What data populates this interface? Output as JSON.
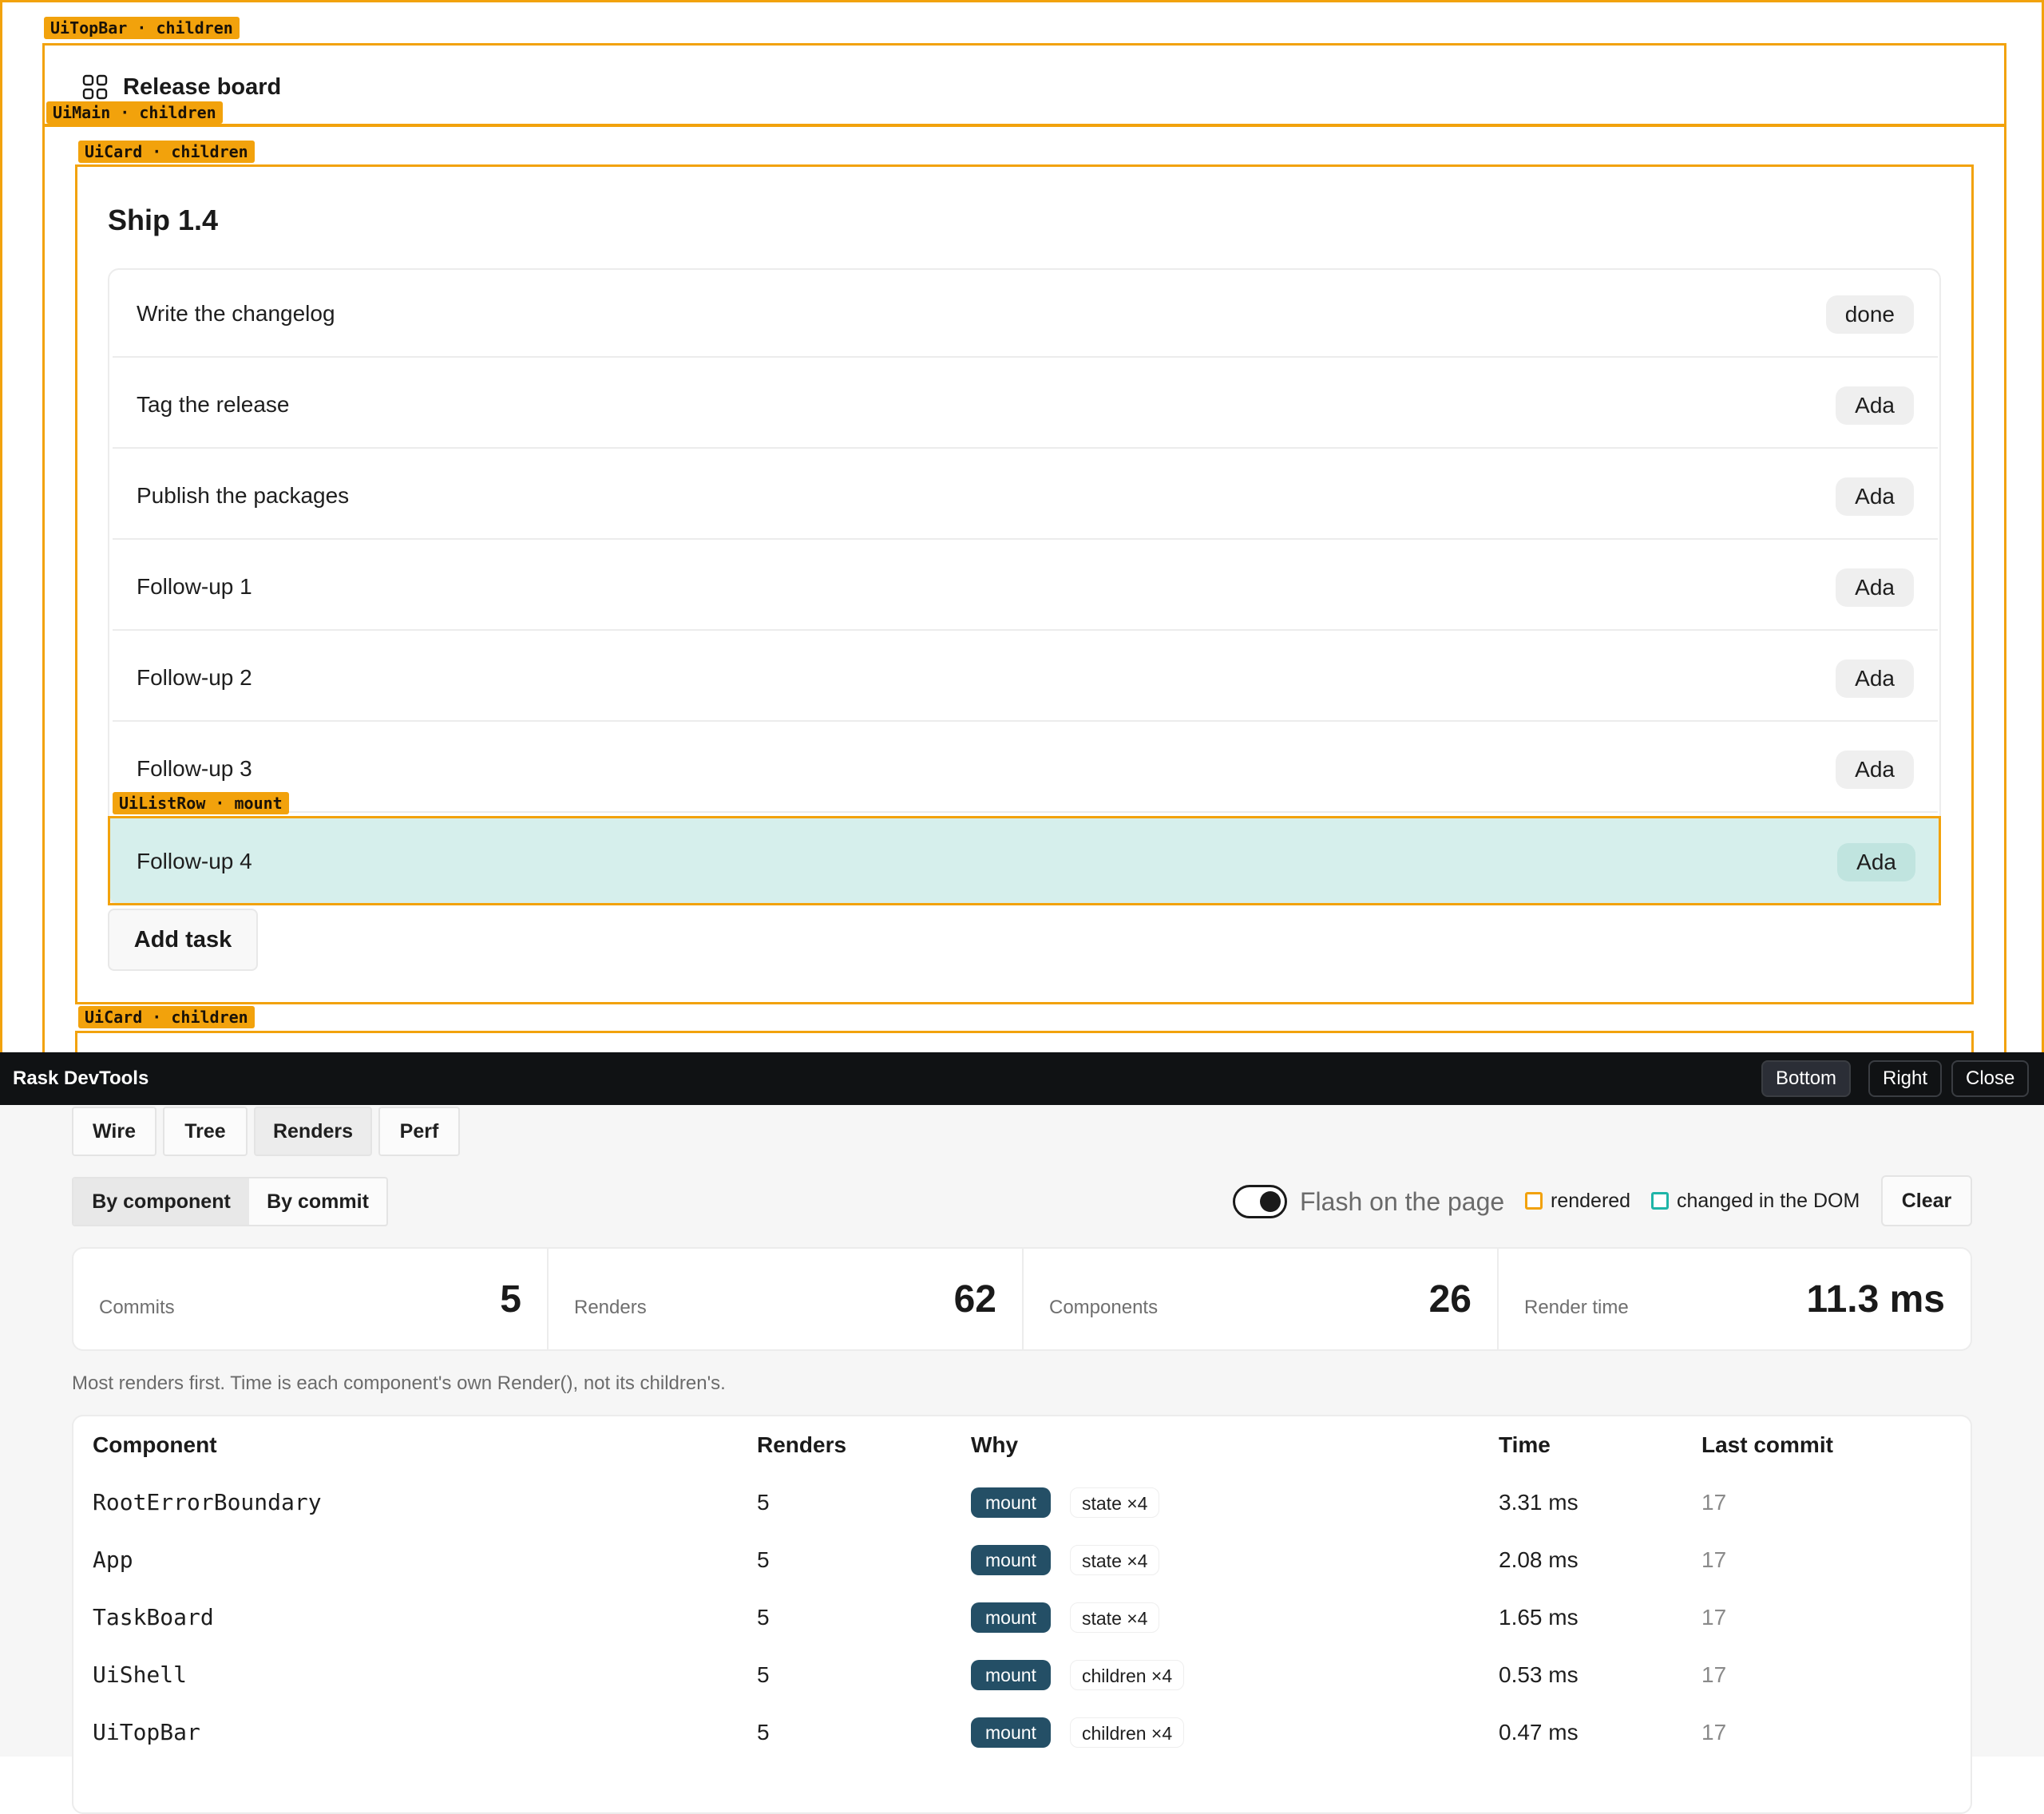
{
  "app": {
    "topbar_tag": "UiTopBar · children",
    "main_tag": "UiMain · children",
    "card_tag": "UiCard · children",
    "card2_tag": "UiCard · children",
    "row_tag": "UiListRow · mount",
    "title": "Release board",
    "card_title": "Ship 1.4",
    "tasks": [
      {
        "label": "Write the changelog",
        "badge": "done"
      },
      {
        "label": "Tag the release",
        "badge": "Ada"
      },
      {
        "label": "Publish the packages",
        "badge": "Ada"
      },
      {
        "label": "Follow-up 1",
        "badge": "Ada"
      },
      {
        "label": "Follow-up 2",
        "badge": "Ada"
      },
      {
        "label": "Follow-up 3",
        "badge": "Ada"
      },
      {
        "label": "Follow-up 4",
        "badge": "Ada"
      }
    ],
    "add_task": "Add task"
  },
  "devtools": {
    "title": "Rask DevTools",
    "dock_buttons": [
      "Bottom",
      "Right",
      "Close"
    ],
    "tabs": [
      "Wire",
      "Tree",
      "Renders",
      "Perf"
    ],
    "active_tab": "Renders",
    "view_modes": [
      "By component",
      "By commit"
    ],
    "flash_label": "Flash on the page",
    "flash_on": true,
    "legend": {
      "rendered": "rendered",
      "changed": "changed in the DOM",
      "rendered_color": "#f2a20c",
      "changed_color": "#1fb5a8"
    },
    "clear": "Clear",
    "stats": [
      {
        "label": "Commits",
        "value": "5"
      },
      {
        "label": "Renders",
        "value": "62"
      },
      {
        "label": "Components",
        "value": "26"
      },
      {
        "label": "Render time",
        "value": "11.3 ms"
      }
    ],
    "note": "Most renders first. Time is each component's own Render(), not its children's.",
    "table": {
      "headers": [
        "Component",
        "Renders",
        "Why",
        "Time",
        "Last commit"
      ],
      "rows": [
        {
          "component": "RootErrorBoundary",
          "renders": "5",
          "why": [
            "mount",
            "state ×4"
          ],
          "time": "3.31 ms",
          "last": "17"
        },
        {
          "component": "App",
          "renders": "5",
          "why": [
            "mount",
            "state ×4"
          ],
          "time": "2.08 ms",
          "last": "17"
        },
        {
          "component": "TaskBoard",
          "renders": "5",
          "why": [
            "mount",
            "state ×4"
          ],
          "time": "1.65 ms",
          "last": "17"
        },
        {
          "component": "UiShell",
          "renders": "5",
          "why": [
            "mount",
            "children ×4"
          ],
          "time": "0.53 ms",
          "last": "17"
        },
        {
          "component": "UiTopBar",
          "renders": "5",
          "why": [
            "mount",
            "children ×4"
          ],
          "time": "0.47 ms",
          "last": "17"
        }
      ]
    }
  },
  "colors": {
    "highlight": "#f2a20c",
    "mount_row": "#d6efec",
    "pill_mount": "#244f66"
  }
}
